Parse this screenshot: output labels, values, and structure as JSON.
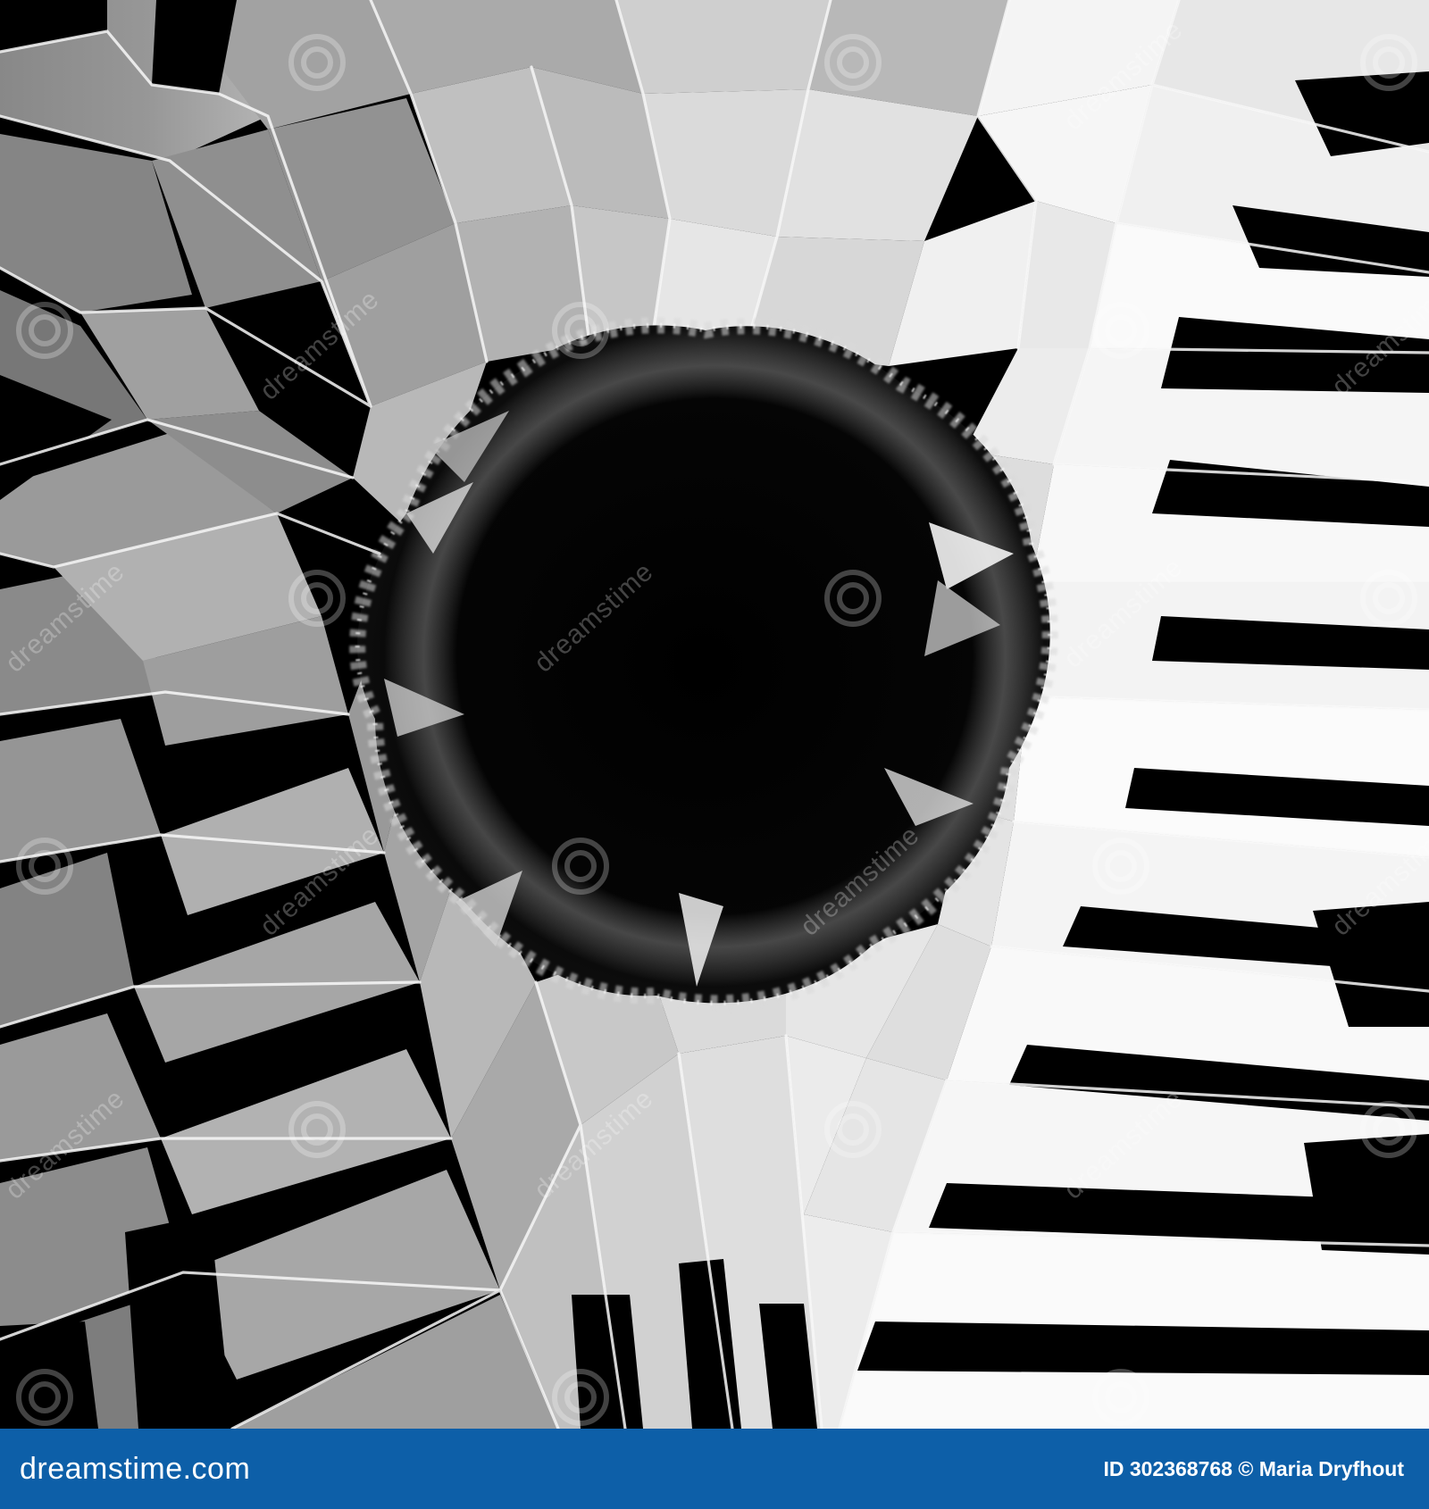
{
  "image": {
    "subject": "",
    "watermark": "dreamstime"
  },
  "footer": {
    "brand": "dreamstime.com",
    "credit": "ID 302368768 © Maria Dryfhout",
    "background_color": "#0d5fa8",
    "text_color": "#ffffff"
  }
}
